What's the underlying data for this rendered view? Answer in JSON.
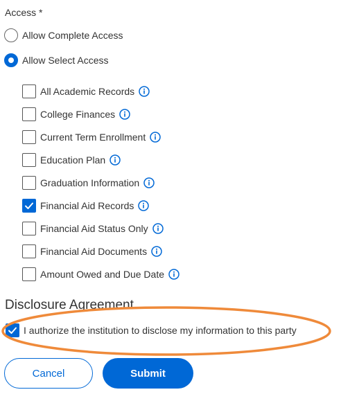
{
  "access": {
    "heading": "Access *",
    "options": [
      {
        "label": "Allow Complete Access",
        "selected": false
      },
      {
        "label": "Allow Select Access",
        "selected": true
      }
    ],
    "records": [
      {
        "label": "All Academic Records",
        "checked": false
      },
      {
        "label": "College Finances",
        "checked": false
      },
      {
        "label": "Current Term Enrollment",
        "checked": false
      },
      {
        "label": "Education Plan",
        "checked": false
      },
      {
        "label": "Graduation Information",
        "checked": false
      },
      {
        "label": "Financial Aid Records",
        "checked": true
      },
      {
        "label": "Financial Aid Status Only",
        "checked": false
      },
      {
        "label": "Financial Aid Documents",
        "checked": false
      },
      {
        "label": "Amount Owed and Due Date",
        "checked": false
      }
    ]
  },
  "disclosure": {
    "heading": "Disclosure Agreement",
    "authorize_label": "I authorize the institution to disclose my information to this party",
    "authorize_checked": true,
    "highlight_color": "#ef8a3a"
  },
  "actions": {
    "cancel_label": "Cancel",
    "submit_label": "Submit"
  },
  "colors": {
    "accent": "#0068d6",
    "text": "#333333"
  },
  "icons": {
    "info": "info-circle-icon",
    "check": "checkmark-icon"
  }
}
